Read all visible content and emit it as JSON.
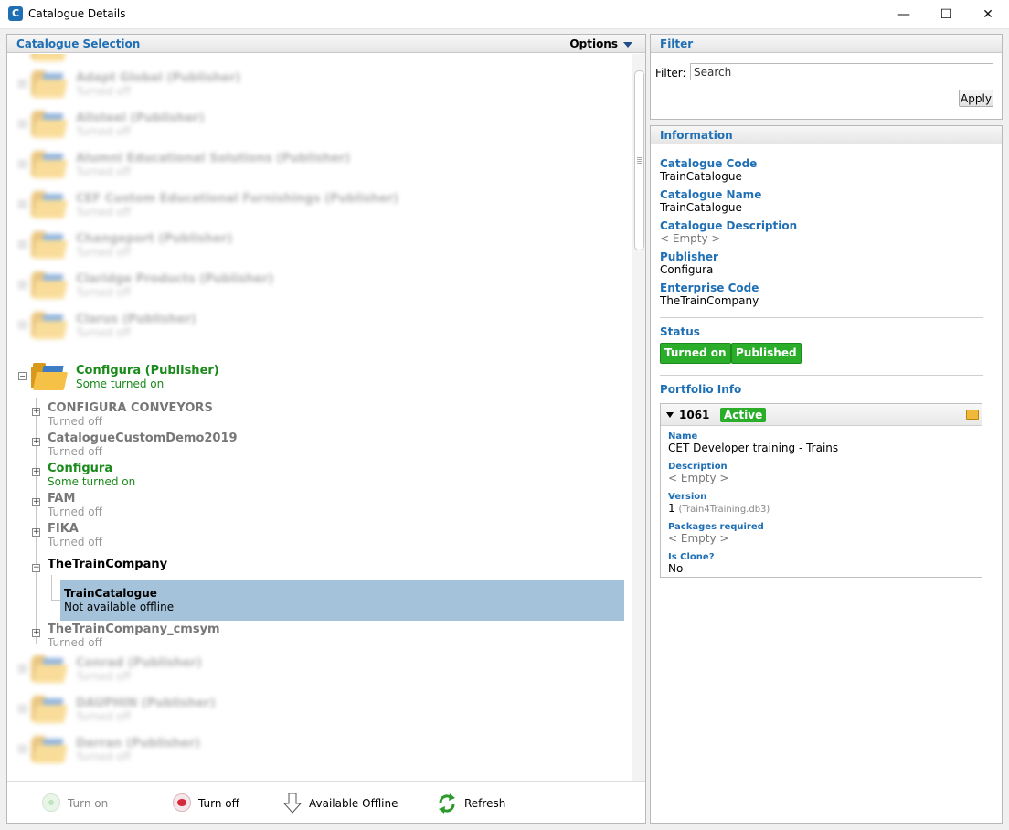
{
  "window": {
    "title": "Catalogue Details",
    "icon": "cet-app-icon"
  },
  "catalogue_selection": {
    "title": "Catalogue Selection",
    "options_label": "Options",
    "publishers_above": [
      {
        "name": "Adapt Global (Publisher)",
        "status": "Turned off"
      },
      {
        "name": "Allsteel (Publisher)",
        "status": "Turned off"
      },
      {
        "name": "Alumni Educational Solutions (Publisher)",
        "status": "Turned off"
      },
      {
        "name": "CEF Custom Educational Furnishings (Publisher)",
        "status": "Turned off"
      },
      {
        "name": "Changeport (Publisher)",
        "status": "Turned off"
      },
      {
        "name": "Claridge Products (Publisher)",
        "status": "Turned off"
      },
      {
        "name": "Clarus (Publisher)",
        "status": "Turned off"
      }
    ],
    "expanded_publisher": {
      "name": "Configura (Publisher)",
      "status": "Some turned on"
    },
    "children": [
      {
        "name": "CONFIGURA CONVEYORS",
        "status": "Turned off"
      },
      {
        "name": "CatalogueCustomDemo2019",
        "status": "Turned off"
      },
      {
        "name": "Configura",
        "status": "Some turned on"
      },
      {
        "name": "FAM",
        "status": "Turned off"
      },
      {
        "name": "FIKA",
        "status": "Turned off"
      }
    ],
    "train_company": {
      "name": "TheTrainCompany"
    },
    "selected_catalogue": {
      "name": "TrainCatalogue",
      "status": "Not available offline"
    },
    "after_child": {
      "name": "TheTrainCompany_cmsym",
      "status": "Turned off"
    },
    "publishers_below": [
      {
        "name": "Conrad (Publisher)",
        "status": "Turned off"
      },
      {
        "name": "DAUPHIN (Publisher)",
        "status": "Turned off"
      },
      {
        "name": "Darran (Publisher)",
        "status": "Turned off"
      }
    ]
  },
  "toolbar": {
    "turn_on": "Turn on",
    "turn_off": "Turn off",
    "available_offline": "Available Offline",
    "refresh": "Refresh"
  },
  "filter": {
    "title": "Filter",
    "label": "Filter:",
    "placeholder": "Search",
    "apply": "Apply"
  },
  "information": {
    "title": "Information",
    "catalogue_code_label": "Catalogue Code",
    "catalogue_code": "TrainCatalogue",
    "catalogue_name_label": "Catalogue Name",
    "catalogue_name": "TrainCatalogue",
    "catalogue_description_label": "Catalogue Description",
    "catalogue_description": "< Empty >",
    "publisher_label": "Publisher",
    "publisher": "Configura",
    "enterprise_code_label": "Enterprise Code",
    "enterprise_code": "TheTrainCompany",
    "status_label": "Status",
    "status_badges": [
      "Turned on",
      "Published"
    ],
    "status_color": "#2aae2a",
    "portfolio_label": "Portfolio Info",
    "portfolio": {
      "id": "1061",
      "state": "Active",
      "name_label": "Name",
      "name": "CET Developer training - Trains",
      "description_label": "Description",
      "description": "< Empty >",
      "version_label": "Version",
      "version": "1",
      "version_file": "(Train4Training.db3)",
      "packages_label": "Packages required",
      "packages": "< Empty >",
      "clone_label": "Is Clone?",
      "clone": "No"
    }
  }
}
